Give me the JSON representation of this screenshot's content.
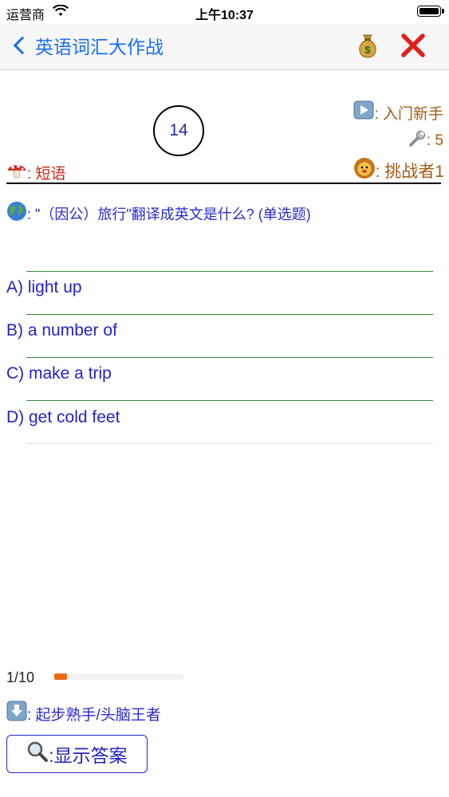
{
  "status_bar": {
    "carrier": "运营商",
    "time": "上午10:37"
  },
  "nav": {
    "back_label": "英语词汇大作战"
  },
  "game": {
    "timer": "14",
    "level": ": 入门新手",
    "tools": ": 5",
    "player": ": 挑战者1",
    "category": ": 短语"
  },
  "question": {
    "text": ": \"（因公）旅行\"翻译成英文是什么? (单选题)"
  },
  "options": [
    {
      "label": "A) light up"
    },
    {
      "label": "B) a number of"
    },
    {
      "label": "C) make a trip"
    },
    {
      "label": "D) get cold feet"
    }
  ],
  "progress": {
    "label": "1/10",
    "current": 1,
    "total": 10
  },
  "footer": {
    "next_level": ": 起步熟手/头脑王者",
    "show_answer": ":显示答案"
  },
  "colors": {
    "accent": "#1a6ff0",
    "option_text": "#2323c6",
    "category": "#d0241a",
    "info": "#a15d14",
    "progress": "#ee6a14"
  }
}
